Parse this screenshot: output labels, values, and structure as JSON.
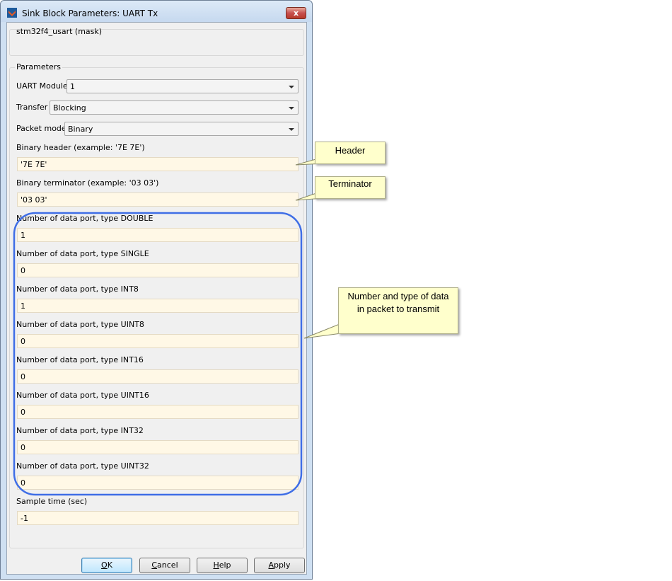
{
  "window": {
    "title": "Sink Block Parameters: UART Tx",
    "close_label": "x"
  },
  "mask": {
    "label": "stm32f4_usart (mask)"
  },
  "parameters": {
    "legend": "Parameters",
    "uart_module": {
      "label": "UART Module",
      "value": "1"
    },
    "transfer": {
      "label": "Transfer",
      "value": "Blocking"
    },
    "packet_mode": {
      "label": "Packet mode",
      "value": "Binary"
    },
    "binary_header": {
      "label": "Binary header (example: '7E 7E')",
      "value": "'7E 7E'"
    },
    "binary_terminator": {
      "label": "Binary terminator (example: '03 03')",
      "value": "'03 03'"
    },
    "data_ports": [
      {
        "label": "Number of data port, type DOUBLE",
        "value": "1"
      },
      {
        "label": "Number of data port, type SINGLE",
        "value": "0"
      },
      {
        "label": "Number of data port, type INT8",
        "value": "1"
      },
      {
        "label": "Number of data port, type UINT8",
        "value": "0"
      },
      {
        "label": "Number of data port, type INT16",
        "value": "0"
      },
      {
        "label": "Number of data port, type UINT16",
        "value": "0"
      },
      {
        "label": "Number of data port, type INT32",
        "value": "0"
      },
      {
        "label": "Number of data port, type UINT32",
        "value": "0"
      }
    ],
    "sample_time": {
      "label": "Sample time (sec)",
      "value": "-1"
    }
  },
  "buttons": {
    "ok": {
      "label": "OK",
      "hotkey": "O",
      "rest": "K"
    },
    "cancel": {
      "label": "Cancel",
      "hotkey": "C",
      "rest": "ancel"
    },
    "help": {
      "label": "Help",
      "hotkey": "H",
      "rest": "elp"
    },
    "apply": {
      "label": "Apply",
      "hotkey": "A",
      "rest": "pply"
    }
  },
  "callouts": {
    "header": "Header",
    "terminator": "Terminator",
    "data_line1": "Number and type of data",
    "data_line2": "in packet to transmit"
  },
  "colors": {
    "callout_bg": "#ffffcc",
    "highlight_outline": "#3f6ee6",
    "field_bg": "#fff8e6"
  }
}
